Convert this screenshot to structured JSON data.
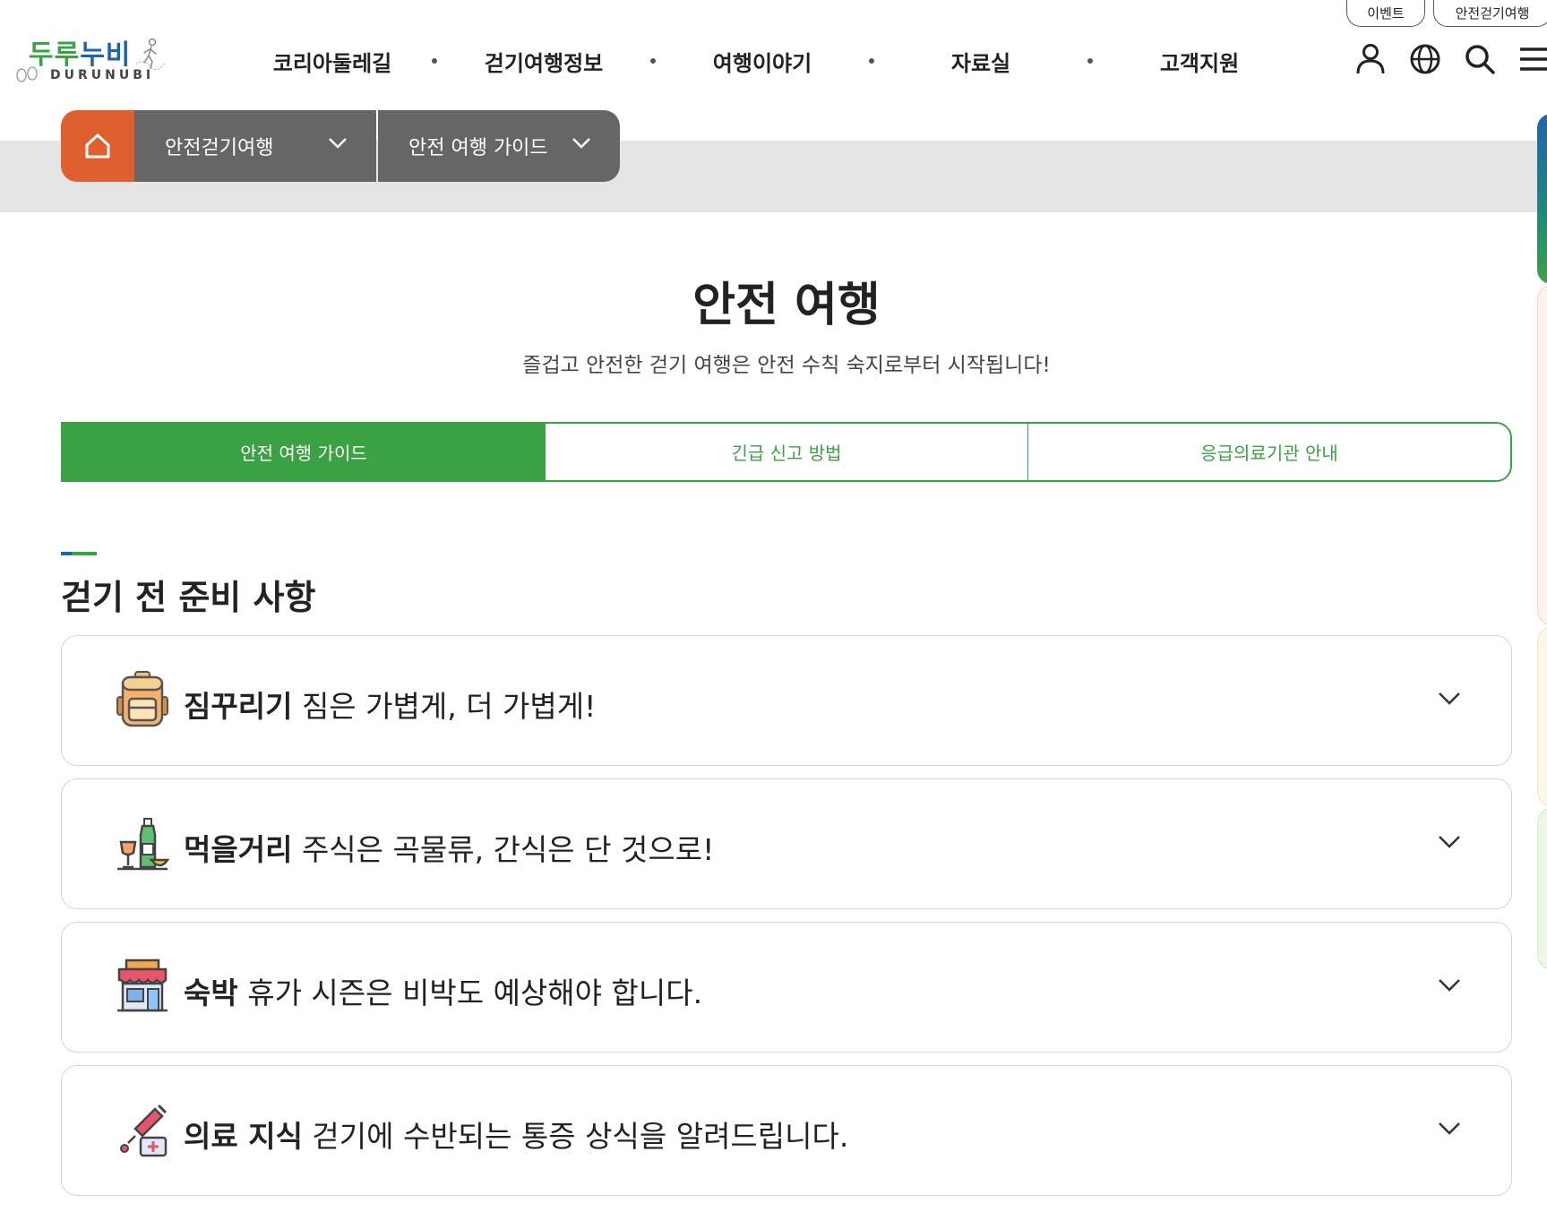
{
  "header": {
    "logo_text_green": "두루",
    "logo_text_blue": "누비",
    "logo_sub": "DURUNUBI",
    "nav": [
      "코리아둘레길",
      "걷기여행정보",
      "여행이야기",
      "자료실",
      "고객지원"
    ],
    "util_links": [
      "이벤트",
      "안전걷기여행"
    ],
    "icons": [
      "user-icon",
      "globe-icon",
      "search-icon",
      "menu-icon"
    ]
  },
  "breadcrumb": {
    "home_icon": "home-icon",
    "level1": "안전걷기여행",
    "level2": "안전 여행 가이드"
  },
  "page": {
    "title": "안전 여행",
    "description": "즐겁고 안전한 걷기 여행은 안전 수칙 숙지로부터 시작됩니다!"
  },
  "tabs": [
    {
      "label": "안전 여행 가이드",
      "active": true
    },
    {
      "label": "긴급 신고 방법",
      "active": false
    },
    {
      "label": "응급의료기관 안내",
      "active": false
    }
  ],
  "section": {
    "title": "걷기 전 준비 사항",
    "items": [
      {
        "bold": "짐꾸리기",
        "text": " 짐은 가볍게, 더 가볍게!",
        "icon": "backpack-icon"
      },
      {
        "bold": "먹을거리",
        "text": " 주식은 곡물류, 간식은 단 것으로!",
        "icon": "food-drink-icon"
      },
      {
        "bold": "숙박",
        "text": " 휴가 시즌은 비박도 예상해야 합니다.",
        "icon": "lodging-shop-icon"
      },
      {
        "bold": "의료 지식",
        "text": " 걷기에 수반되는 통증 상식을 알려드립니다.",
        "icon": "medical-syringe-icon"
      }
    ]
  },
  "colors": {
    "green": "#3ba244",
    "blue": "#1f63ae",
    "orange": "#e05f2e",
    "crumb_gray": "#666666",
    "band_gray": "#e5e5e5"
  }
}
